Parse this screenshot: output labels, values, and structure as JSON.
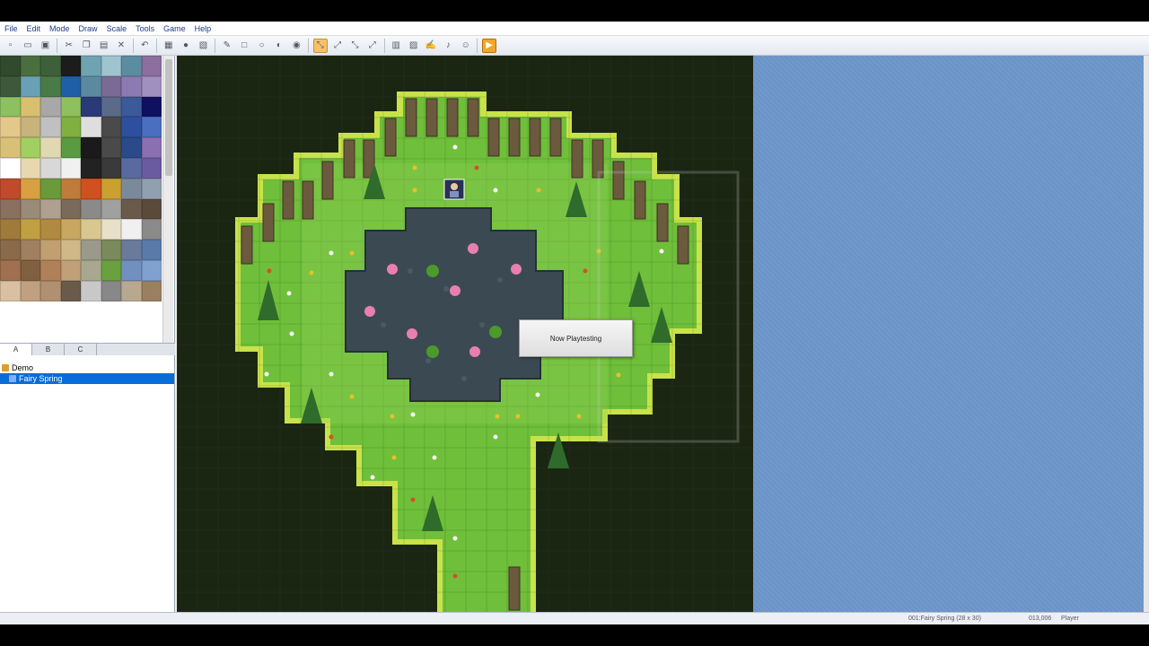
{
  "menu": [
    "File",
    "Edit",
    "Mode",
    "Draw",
    "Scale",
    "Tools",
    "Game",
    "Help"
  ],
  "toolbar": {
    "icons": [
      "new-project-icon",
      "open-project-icon",
      "save-project-icon",
      "sep",
      "cut-icon",
      "copy-icon",
      "paste-icon",
      "delete-icon",
      "sep",
      "undo-icon",
      "sep",
      "map-mode-icon",
      "event-mode-icon",
      "region-mode-icon",
      "sep",
      "pencil-icon",
      "rectangle-icon",
      "ellipse-icon",
      "flood-fill-icon",
      "shadow-pen-icon",
      "sep",
      "zoom-1-1-icon",
      "zoom-1-2-icon",
      "zoom-1-4-icon",
      "zoom-1-8-icon",
      "sep",
      "database-icon",
      "resource-manager-icon",
      "script-editor-icon",
      "sound-test-icon",
      "character-generator-icon",
      "sep",
      "playtest-icon"
    ],
    "glyphs": {
      "new-project-icon": "▫",
      "open-project-icon": "▭",
      "save-project-icon": "▣",
      "cut-icon": "✂",
      "copy-icon": "❐",
      "paste-icon": "▤",
      "delete-icon": "✕",
      "undo-icon": "↶",
      "map-mode-icon": "▦",
      "event-mode-icon": "●",
      "region-mode-icon": "▧",
      "pencil-icon": "✎",
      "rectangle-icon": "□",
      "ellipse-icon": "○",
      "flood-fill-icon": "◐",
      "shadow-pen-icon": "◉",
      "zoom-1-1-icon": "⤡",
      "zoom-1-2-icon": "⤢",
      "zoom-1-4-icon": "⤡",
      "zoom-1-8-icon": "⤢",
      "database-icon": "▥",
      "resource-manager-icon": "▨",
      "script-editor-icon": "✍",
      "sound-test-icon": "♪",
      "character-generator-icon": "☺",
      "playtest-icon": "▶"
    },
    "active": [
      "zoom-1-1-icon"
    ]
  },
  "tileset_tabs": [
    "A",
    "B",
    "C"
  ],
  "map_tree": {
    "project": "Demo",
    "maps": [
      "Fairy Spring"
    ]
  },
  "playtest_dialog": "Now Playtesting",
  "status": {
    "map": "001:Fairy Spring (28 x 30)",
    "coords": "013,006",
    "mode": "Player"
  },
  "colors": {
    "grass": "#6fbf3a",
    "dark_grass": "#4c9a2a",
    "hedge": "#c9e24a",
    "water": "#3b4a52",
    "trunk": "#6b5a3e",
    "background": "#1a2612",
    "selected_map": "#0a6cd8"
  },
  "tiles": [
    "#2f4a2c",
    "#4b6e3e",
    "#3d5f3a",
    "#1c1c1c",
    "#6fa3b2",
    "#9ec4d0",
    "#5a8d9f",
    "#8c6e9f",
    "#3c5a3a",
    "#6aa0b6",
    "#4a7a45",
    "#1f5fa8",
    "#5b8aa0",
    "#7a6a95",
    "#8c7ab0",
    "#a090c0",
    "#8cc060",
    "#d9c070",
    "#a8a8a8",
    "#8fc060",
    "#2a3a78",
    "#5a6a8a",
    "#3a5a9a",
    "#101060",
    "#e3c88a",
    "#c7b37b",
    "#c0c0c0",
    "#7fb040",
    "#dedede",
    "#4a4a4a",
    "#2e4fa0",
    "#4a6ec0",
    "#d8c078",
    "#a0d060",
    "#e0d8b0",
    "#5a9a40",
    "#1a1a1a",
    "#4a4a4a",
    "#2a4a8a",
    "#8a70b0",
    "#ffffff",
    "#e8d8b0",
    "#d8d8d8",
    "#f0f0f0",
    "#222222",
    "#3a3a3a",
    "#5a6aa0",
    "#6a5aa0",
    "#c04a2a",
    "#d8a040",
    "#6a9a3a",
    "#c07a3a",
    "#d05020",
    "#caa030",
    "#7a8a9a",
    "#90a0b0",
    "#8a7060",
    "#9a8a78",
    "#b0a090",
    "#7a6a5a",
    "#8a8a8a",
    "#a0a0a0",
    "#6a5a4a",
    "#5a4a3a",
    "#a07a3a",
    "#c0a040",
    "#b08a40",
    "#c8a860",
    "#d8c890",
    "#e8e0c8",
    "#f0f0f0",
    "#8a8a8a",
    "#8a6a4a",
    "#a08060",
    "#c0a070",
    "#d0b888",
    "#9a9a8a",
    "#7a8a5a",
    "#6a7a9a",
    "#5a7aaa",
    "#a07050",
    "#806040",
    "#b08058",
    "#c0a078",
    "#a8a890",
    "#6aa040",
    "#7090c0",
    "#80a0d0",
    "#d8c0a0",
    "#c0a080",
    "#b09070",
    "#6a5a4a",
    "#c8c8c8",
    "#888888",
    "#b8a890",
    "#9a8060"
  ]
}
